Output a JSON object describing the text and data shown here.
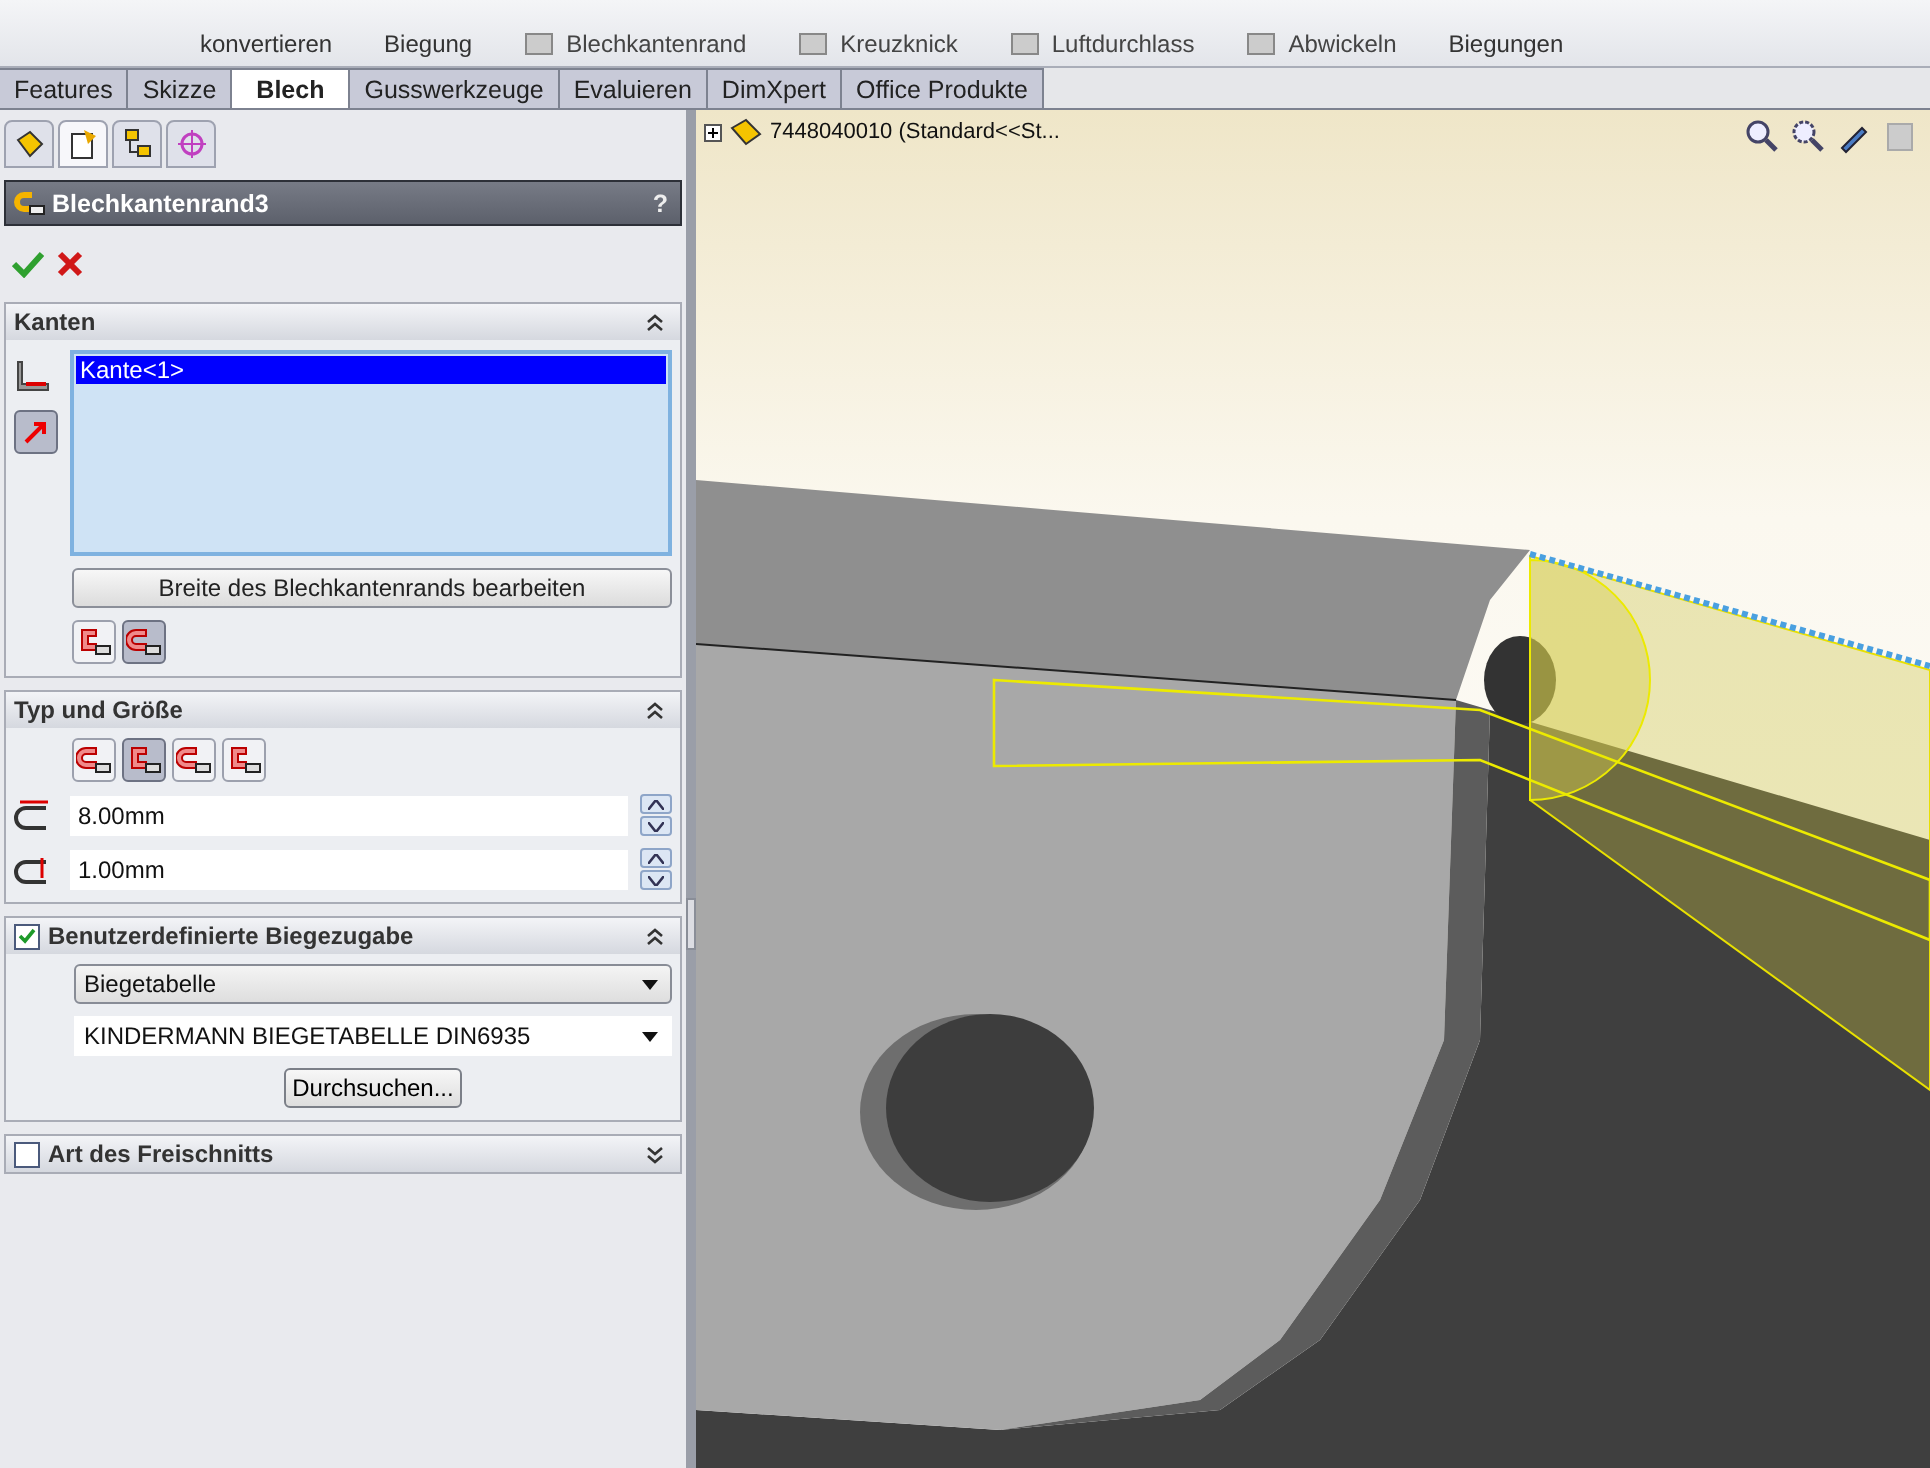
{
  "ribbon": {
    "items": [
      {
        "kind": "big",
        "label": "konvertieren"
      },
      {
        "kind": "big",
        "label": "Biegung"
      },
      {
        "kind": "small",
        "label": "Blechkantenrand"
      },
      {
        "kind": "small",
        "label": "Kreuzknick"
      },
      {
        "kind": "small",
        "label": "Luftdurchlass"
      },
      {
        "kind": "small",
        "label": "Abwickeln"
      },
      {
        "kind": "big",
        "label": "Biegungen"
      }
    ]
  },
  "tabs": [
    {
      "label": "Features",
      "selected": false
    },
    {
      "label": "Skizze",
      "selected": false
    },
    {
      "label": "Blech",
      "selected": true
    },
    {
      "label": "Gusswerkzeuge",
      "selected": false
    },
    {
      "label": "Evaluieren",
      "selected": false
    },
    {
      "label": "DimXpert",
      "selected": false
    },
    {
      "label": "Office Produkte",
      "selected": false
    }
  ],
  "manager_tabs": [
    {
      "kind": "feature",
      "selected": false
    },
    {
      "kind": "property",
      "selected": true
    },
    {
      "kind": "config",
      "selected": false
    },
    {
      "kind": "dim",
      "selected": false
    }
  ],
  "property_manager": {
    "title": "Blechkantenrand3",
    "help": "?",
    "sections": [
      {
        "kind": "plain",
        "title": "Kanten",
        "expanded": true,
        "list": {
          "items": [
            {
              "label": "Kante<1>",
              "selected": true
            }
          ]
        },
        "button": "Breite des Blechkantenrands bearbeiten",
        "icon_buttons": [
          {
            "selected": false
          },
          {
            "selected": true
          }
        ]
      },
      {
        "kind": "plain",
        "title": "Typ und Größe",
        "expanded": true,
        "icon_buttons": [
          {
            "selected": false
          },
          {
            "selected": true
          },
          {
            "selected": false
          },
          {
            "selected": false
          }
        ],
        "fields": [
          {
            "value": "8.00mm"
          },
          {
            "value": "1.00mm"
          }
        ]
      },
      {
        "kind": "check",
        "title": "Benutzerdefinierte Biegezugabe",
        "checked": true,
        "expanded": true,
        "dropdowns": [
          {
            "kind": "combo",
            "value": "Biegetabelle"
          },
          {
            "kind": "select",
            "value": "KINDERMANN BIEGETABELLE DIN6935"
          }
        ],
        "browse_button": "Durchsuchen..."
      },
      {
        "kind": "check",
        "title": "Art des Freischnitts",
        "checked": false,
        "expanded": false
      }
    ]
  },
  "viewport": {
    "tree_item": "7448040010  (Standard<<St..."
  }
}
